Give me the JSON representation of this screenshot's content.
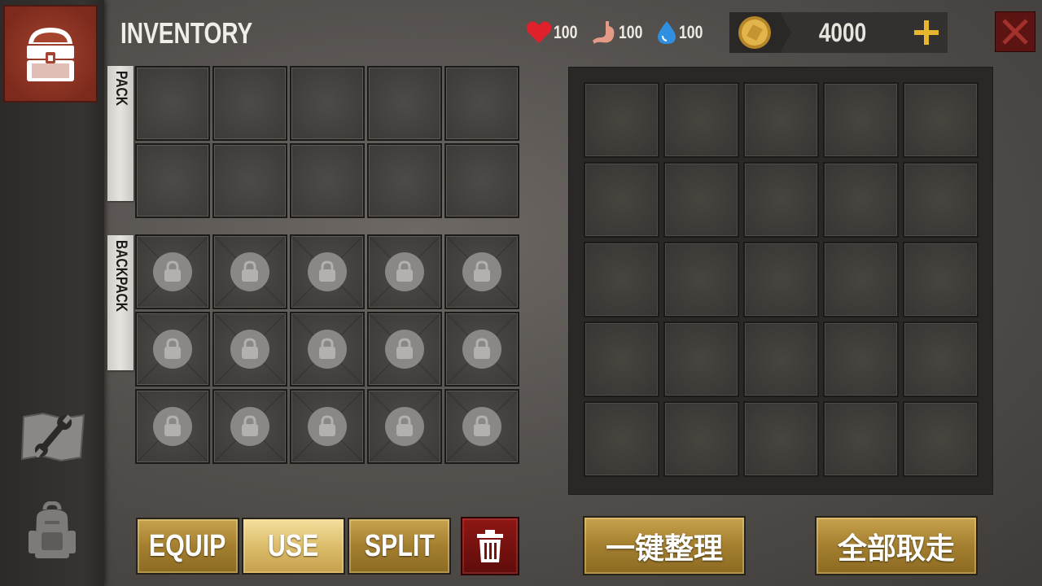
{
  "header": {
    "title": "INVENTORY"
  },
  "stats": [
    {
      "id": "health",
      "icon": "heart-icon",
      "value": "100",
      "color": "#e0202a"
    },
    {
      "id": "hunger",
      "icon": "stomach-icon",
      "value": "100",
      "color": "#e49a85"
    },
    {
      "id": "thirst",
      "icon": "water-drop-icon",
      "value": "100",
      "color": "#2f8fe0"
    }
  ],
  "currency": {
    "amount": "4000",
    "add_symbol": "+"
  },
  "labels": {
    "pack": "PACK",
    "backpack": "BACKPACK"
  },
  "pack_grid": {
    "rows": 2,
    "cols": 5,
    "locked": false
  },
  "backpack_grid": {
    "rows": 3,
    "cols": 5,
    "locked": true
  },
  "storage_grid": {
    "rows": 5,
    "cols": 5
  },
  "actions": {
    "equip": "EQUIP",
    "use": "USE",
    "split": "SPLIT",
    "sort": "一键整理",
    "take_all": "全部取走"
  },
  "colors": {
    "accent_gold": "#c7a34f",
    "danger_red": "#8e1714",
    "chest_tab": "#a5442f"
  }
}
